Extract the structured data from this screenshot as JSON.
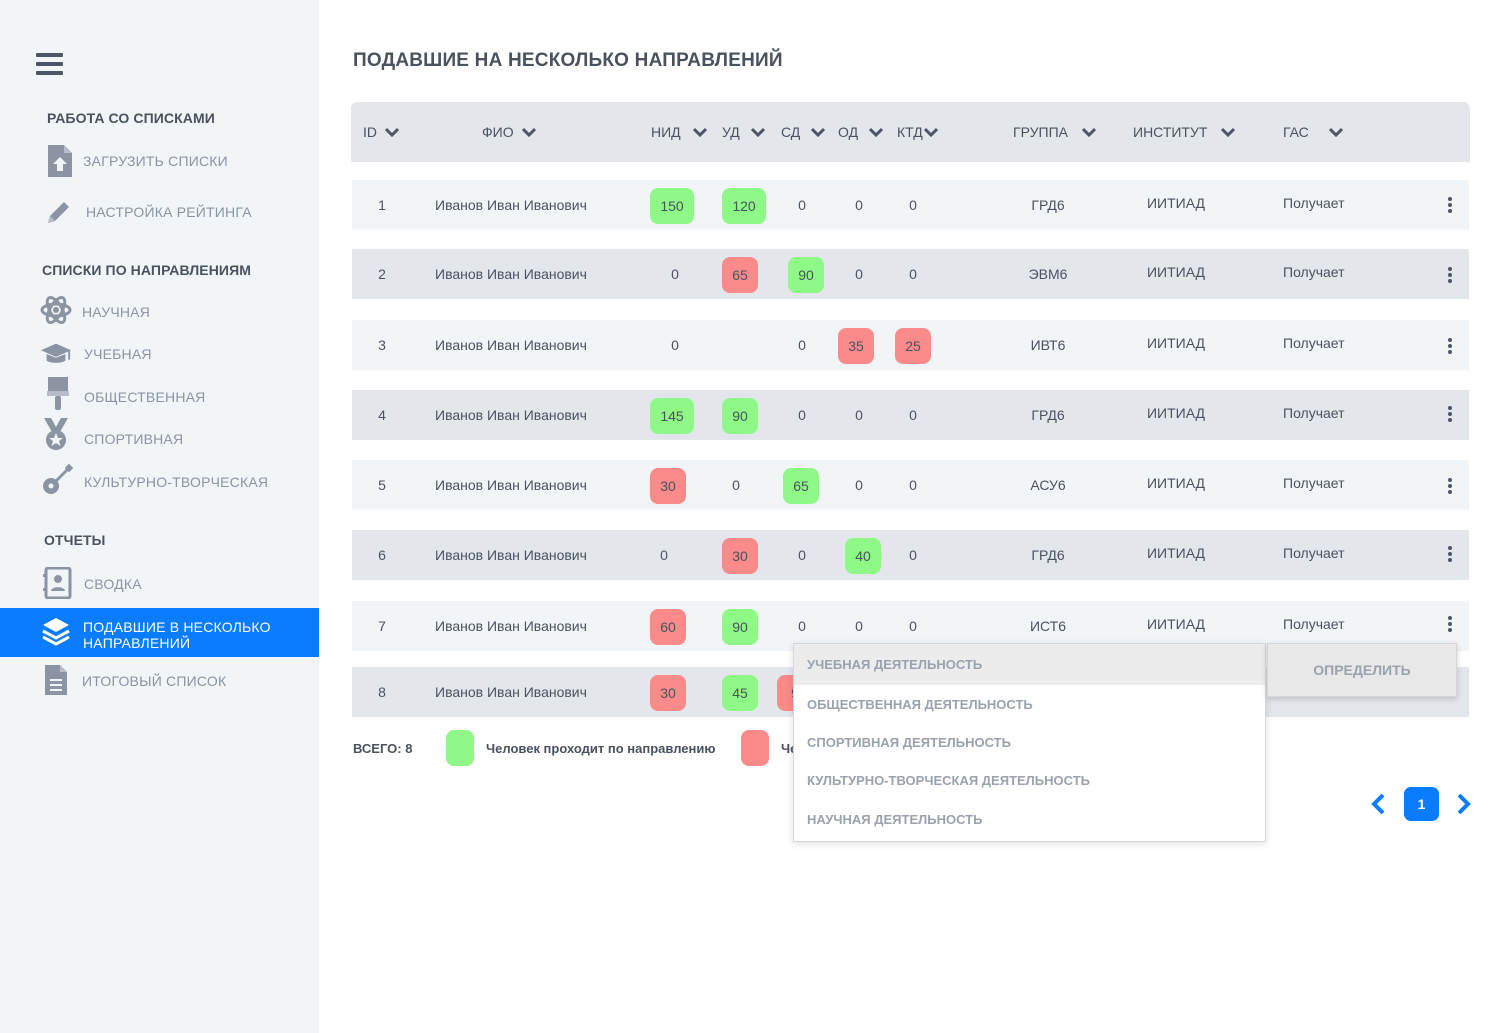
{
  "page_title": "ПОДАВШИЕ НА НЕСКОЛЬКО НАПРАВЛЕНИЙ",
  "sidebar": {
    "sections": [
      "РАБОТА СО СПИСКАМИ",
      "СПИСКИ ПО НАПРАВЛЕНИЯМ",
      "ОТЧЕТЫ"
    ],
    "items": [
      {
        "label": "ЗАГРУЗИТЬ СПИСКИ",
        "icon": "upload-file-icon"
      },
      {
        "label": "НАСТРОЙКА РЕЙТИНГА",
        "icon": "pencil-icon"
      },
      {
        "label": "НАУЧНАЯ",
        "icon": "atom-icon"
      },
      {
        "label": "УЧЕБНАЯ",
        "icon": "graduation-cap-icon"
      },
      {
        "label": "ОБЩЕСТВЕННАЯ",
        "icon": "paint-brush-icon"
      },
      {
        "label": "СПОРТИВНАЯ",
        "icon": "medal-icon"
      },
      {
        "label": "КУЛЬТУРНО-ТВОРЧЕСКАЯ",
        "icon": "guitar-icon"
      },
      {
        "label": "СВОДКА",
        "icon": "contact-book-icon"
      },
      {
        "label_line1": "ПОДАВШИЕ В НЕСКОЛЬКО",
        "label_line2": "НАПРАВЛЕНИЙ",
        "icon": "layers-icon"
      },
      {
        "label": "ИТОГОВЫЙ СПИСОК",
        "icon": "document-icon"
      }
    ],
    "active_color": "#0a7cff"
  },
  "table": {
    "headers": [
      "ID",
      "ФИО",
      "НИД",
      "УД",
      "СД",
      "ОД",
      "КТД",
      "ГРУППА",
      "ИНСТИТУТ",
      "ГАС"
    ],
    "rows": [
      {
        "id": "1",
        "name": "Иванов Иван Иванович",
        "nid": "150",
        "ud": "120",
        "sd": "0",
        "od": "0",
        "ktd": "0",
        "group": "ГРД6",
        "inst": "ИИТИАД",
        "gas": "Получает"
      },
      {
        "id": "2",
        "name": "Иванов Иван Иванович",
        "nid": "0",
        "ud": "65",
        "sd": "90",
        "od": "0",
        "ktd": "0",
        "group": "ЭВМ6",
        "inst": "ИИТИАД",
        "gas": "Получает"
      },
      {
        "id": "3",
        "name": "Иванов Иван Иванович",
        "nid": "0",
        "ud": "",
        "sd": "0",
        "od": "35",
        "ktd": "25",
        "group": "ИВТ6",
        "inst": "ИИТИАД",
        "gas": "Получает"
      },
      {
        "id": "4",
        "name": "Иванов Иван Иванович",
        "nid": "145",
        "ud": "90",
        "sd": "0",
        "od": "0",
        "ktd": "0",
        "group": "ГРД6",
        "inst": "ИИТИАД",
        "gas": "Получает"
      },
      {
        "id": "5",
        "name": "Иванов Иван Иванович",
        "nid": "30",
        "ud": "0",
        "sd": "65",
        "od": "0",
        "ktd": "0",
        "group": "АСУ6",
        "inst": "ИИТИАД",
        "gas": "Получает"
      },
      {
        "id": "6",
        "name": "Иванов Иван Иванович",
        "nid": "0",
        "ud": "30",
        "sd": "0",
        "od": "40",
        "ktd": "0",
        "group": "ГРД6",
        "inst": "ИИТИАД",
        "gas": "Получает"
      },
      {
        "id": "7",
        "name": "Иванов Иван Иванович",
        "nid": "60",
        "ud": "90",
        "sd": "0",
        "od": "0",
        "ktd": "0",
        "group": "ИСТ6",
        "inst": "ИИТИАД",
        "gas": "Получает"
      },
      {
        "id": "8",
        "name": "Иванов Иван Иванович",
        "nid": "30",
        "ud": "45",
        "sd": "9"
      }
    ],
    "colors": {
      "pass": "#8ef986",
      "fail": "#fb8a8a"
    }
  },
  "legend": {
    "total": "ВСЕГО: 8",
    "pass_text": "Человек проходит по направлению",
    "fail_text": "Че"
  },
  "dropdown": {
    "items": [
      "УЧЕБНАЯ ДЕЯТЕЛЬНОСТЬ",
      "ОБЩЕСТВЕННАЯ ДЕЯТЕЛЬНОСТЬ",
      "СПОРТИВНАЯ ДЕЯТЕЛЬНОСТЬ",
      "КУЛЬТУРНО-ТВОРЧЕСКАЯ ДЕЯТЕЛЬНОСТЬ",
      "НАУЧНАЯ ДЕЯТЕЛЬНОСТЬ"
    ],
    "button": "ОПРЕДЕЛИТЬ"
  },
  "pager": {
    "current": "1"
  }
}
